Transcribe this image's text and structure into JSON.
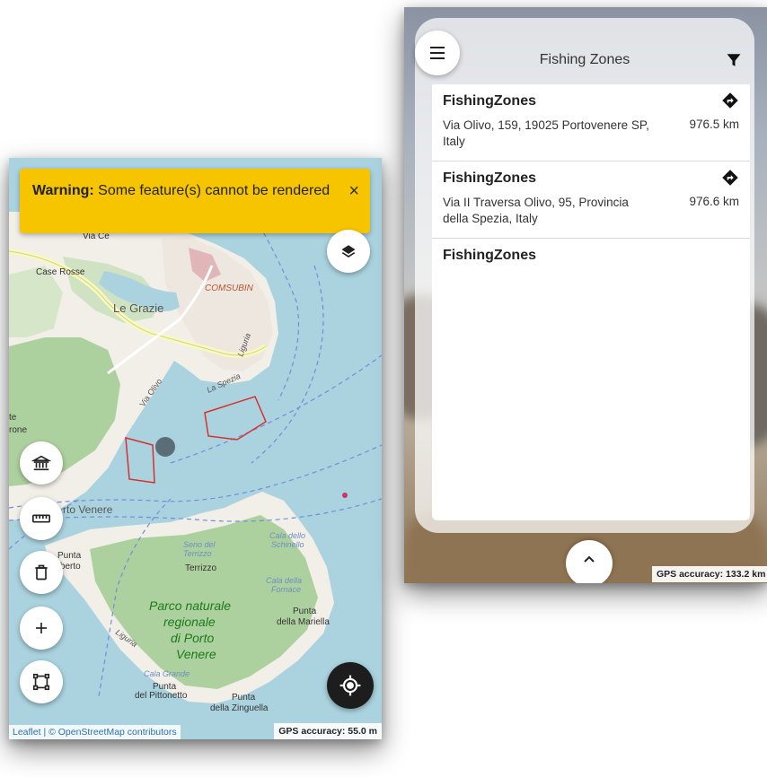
{
  "map_view": {
    "warning": {
      "label": "Warning:",
      "message": " Some feature(s) cannot be rendered",
      "close": "×"
    },
    "labels": {
      "via": "Via Ce",
      "case_rosse": "Case Rosse",
      "le_grazie": "Le Grazie",
      "comsubin": "COMSUBIN",
      "via_olivo": "Via Olivo",
      "la_spezia": "La Spezia",
      "liguria": "Liguria",
      "te": "te",
      "rone": "rone",
      "rto_venere": "rto Venere",
      "punta_alberto_1": "Punta",
      "punta_alberto_2": "Alberto",
      "terrizzo": "Terrizzo",
      "seno_1": "Seno del",
      "seno_2": "Terrizzo",
      "cala_schinello_1": "Cala dello",
      "cala_schinello_2": "Schinello",
      "cala_fornace_1": "Cala della",
      "cala_fornace_2": "Fornace",
      "park_1": "Parco naturale",
      "park_2": "regionale",
      "park_3": "di Porto",
      "park_4": "Venere",
      "punta_mariella_1": "Punta",
      "punta_mariella_2": "della Mariella",
      "cala_grande": "Cala Grande",
      "punta_pittonetto_1": "Punta",
      "punta_pittonetto_2": "del Pittonetto",
      "punta_zinguella_1": "Punta",
      "punta_zinguella_2": "della Zinguella",
      "liguria2": "Liguria"
    },
    "attribution": "Leaflet | © OpenStreetMap contributors",
    "gps_accuracy": "GPS accuracy: 55.0 m",
    "icons": [
      "layers-icon",
      "museum-icon",
      "ruler-icon",
      "trash-icon",
      "plus-icon",
      "polygon-draw-icon",
      "locate-icon"
    ]
  },
  "list_view": {
    "title": "Fishing Zones",
    "items": [
      {
        "name": "FishingZones",
        "address": "Via Olivo, 159, 19025 Portovenere SP, Italy",
        "distance": "976.5 km"
      },
      {
        "name": "FishingZones",
        "address": "Via II Traversa Olivo, 95, Provincia della Spezia, Italy",
        "distance": "976.6 km"
      },
      {
        "name": "FishingZones"
      }
    ],
    "gps_accuracy": "GPS accuracy: 133.2 km",
    "icons": [
      "menu-icon",
      "filter-icon",
      "directions-icon",
      "chevron-up-icon"
    ]
  },
  "colors": {
    "water": "#aad3df",
    "warning": "#f6c500",
    "zone_outline": "#d9302c",
    "fab_dark": "#1d1d1d"
  }
}
